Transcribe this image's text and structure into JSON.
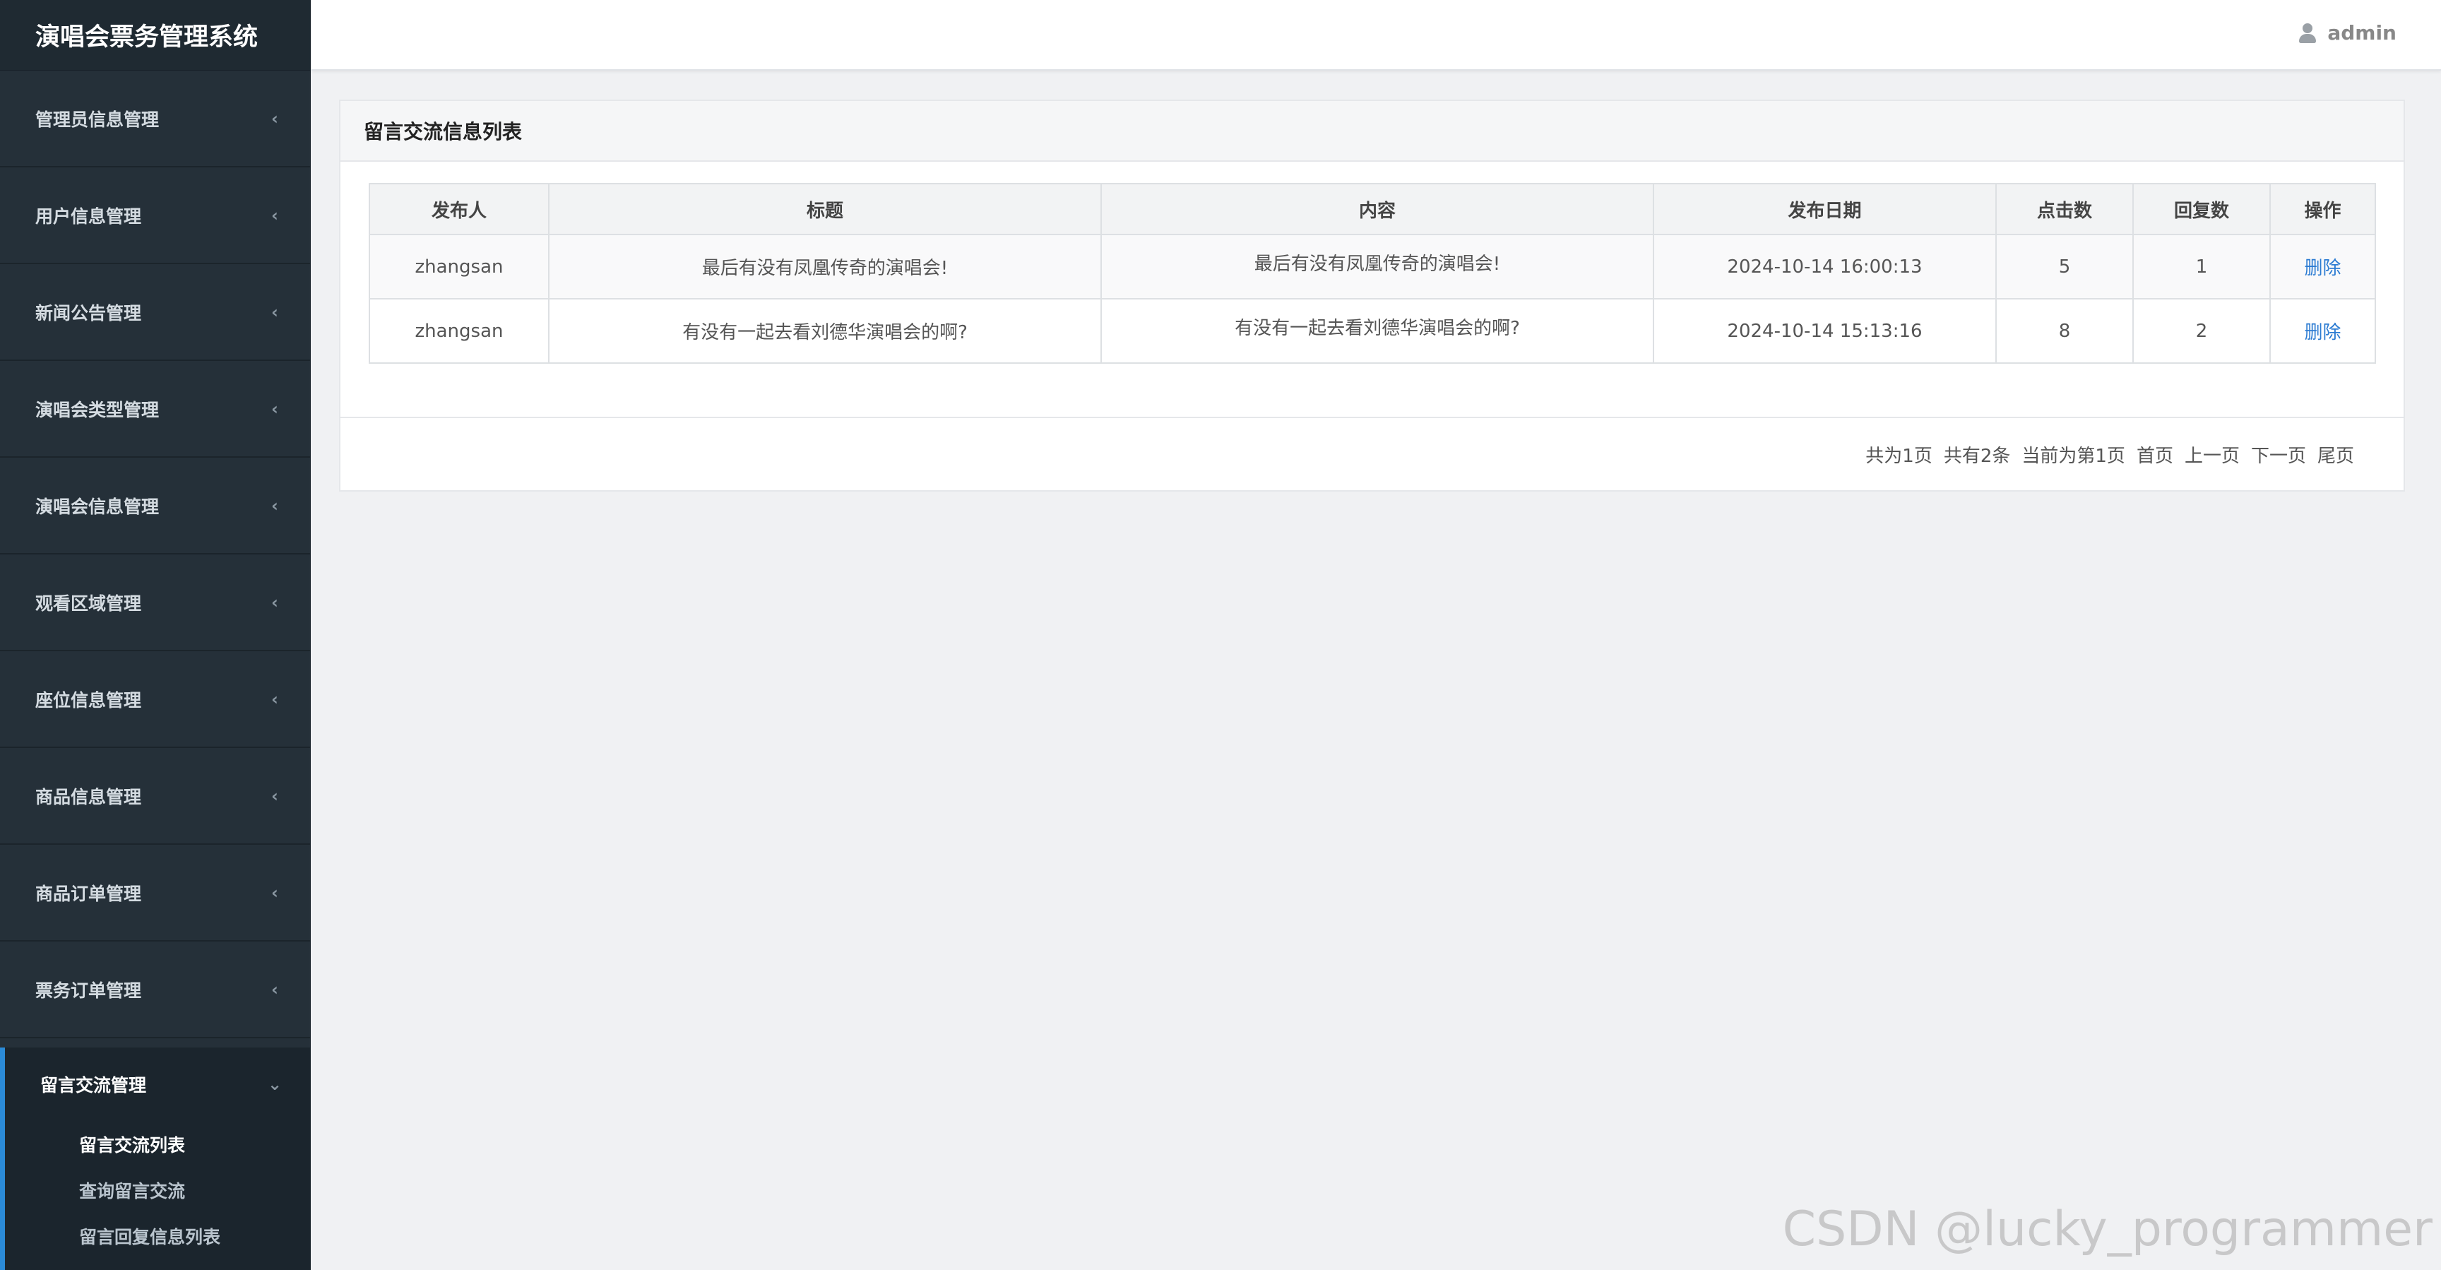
{
  "app": {
    "title": "演唱会票务管理系统"
  },
  "header": {
    "user": "admin"
  },
  "sidebar": {
    "items": [
      {
        "label": "管理员信息管理"
      },
      {
        "label": "用户信息管理"
      },
      {
        "label": "新闻公告管理"
      },
      {
        "label": "演唱会类型管理"
      },
      {
        "label": "演唱会信息管理"
      },
      {
        "label": "观看区域管理"
      },
      {
        "label": "座位信息管理"
      },
      {
        "label": "商品信息管理"
      },
      {
        "label": "商品订单管理"
      },
      {
        "label": "票务订单管理"
      }
    ],
    "active": {
      "label": "留言交流管理",
      "subitems": [
        {
          "label": "留言交流列表"
        },
        {
          "label": "查询留言交流"
        },
        {
          "label": "留言回复信息列表"
        }
      ]
    }
  },
  "panel": {
    "title": "留言交流信息列表",
    "columns": [
      "发布人",
      "标题",
      "内容",
      "发布日期",
      "点击数",
      "回复数",
      "操作"
    ],
    "rows": [
      {
        "publisher": "zhangsan",
        "title": "最后有没有凤凰传奇的演唱会!",
        "content": "最后有没有凤凰传奇的演唱会!",
        "date": "2024-10-14 16:00:13",
        "clicks": "5",
        "replies": "1",
        "action": "删除"
      },
      {
        "publisher": "zhangsan",
        "title": "有没有一起去看刘德华演唱会的啊?",
        "content": "有没有一起去看刘德华演唱会的啊?",
        "date": "2024-10-14 15:13:16",
        "clicks": "8",
        "replies": "2",
        "action": "删除"
      }
    ],
    "pagination": {
      "total_pages": "共为1页",
      "total_records": "共有2条",
      "current": "当前为第1页",
      "first": "首页",
      "prev": "上一页",
      "next": "下一页",
      "last": "尾页"
    }
  },
  "watermark": "CSDN @lucky_programmer"
}
